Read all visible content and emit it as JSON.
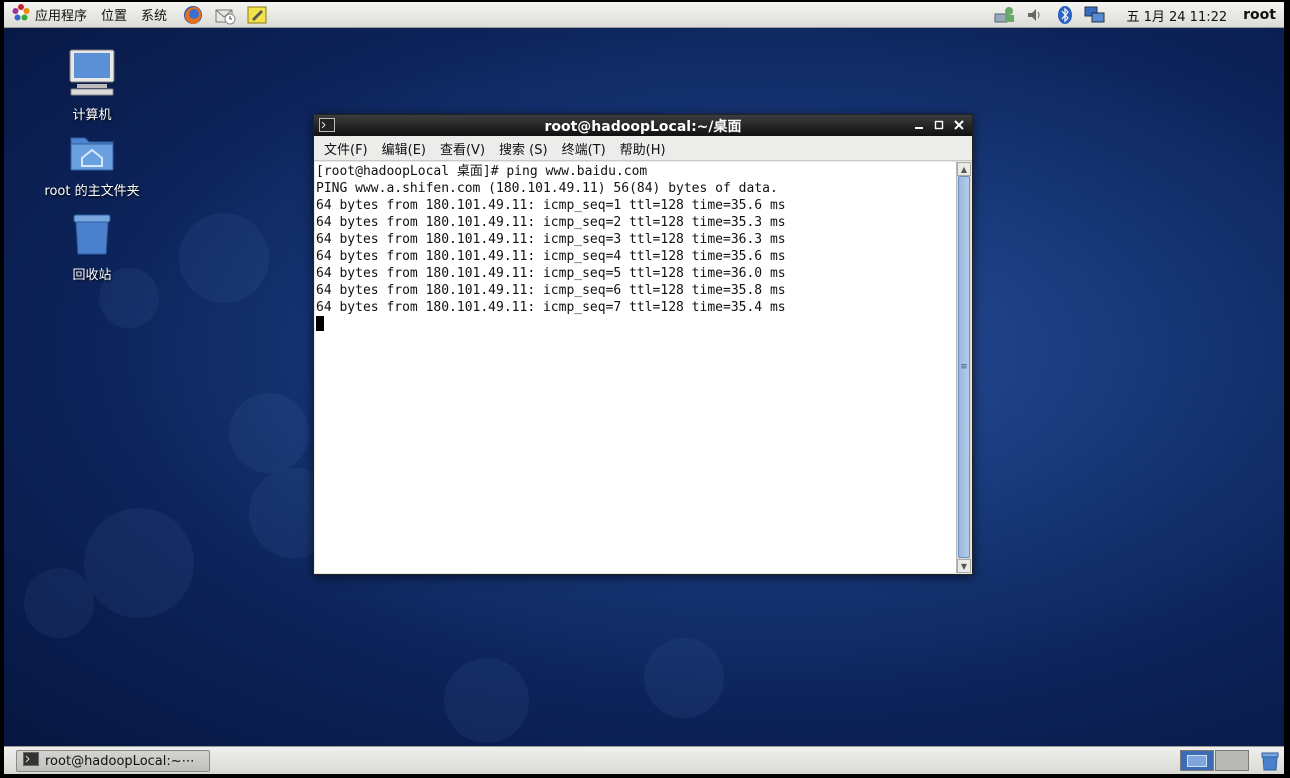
{
  "top_panel": {
    "menus": [
      {
        "label": "应用程序"
      },
      {
        "label": "位置"
      },
      {
        "label": "系统"
      }
    ],
    "clock": "五 1月 24 11:22",
    "user": "root"
  },
  "desktop": {
    "icons": [
      {
        "label": "计算机"
      },
      {
        "label": "root 的主文件夹"
      },
      {
        "label": "回收站"
      }
    ]
  },
  "terminal": {
    "title": "root@hadoopLocal:~/桌面",
    "menu": [
      "文件(F)",
      "编辑(E)",
      "查看(V)",
      "搜索 (S)",
      "终端(T)",
      "帮助(H)"
    ],
    "lines": [
      "[root@hadoopLocal 桌面]# ping www.baidu.com",
      "PING www.a.shifen.com (180.101.49.11) 56(84) bytes of data.",
      "64 bytes from 180.101.49.11: icmp_seq=1 ttl=128 time=35.6 ms",
      "64 bytes from 180.101.49.11: icmp_seq=2 ttl=128 time=35.3 ms",
      "64 bytes from 180.101.49.11: icmp_seq=3 ttl=128 time=36.3 ms",
      "64 bytes from 180.101.49.11: icmp_seq=4 ttl=128 time=35.6 ms",
      "64 bytes from 180.101.49.11: icmp_seq=5 ttl=128 time=36.0 ms",
      "64 bytes from 180.101.49.11: icmp_seq=6 ttl=128 time=35.8 ms",
      "64 bytes from 180.101.49.11: icmp_seq=7 ttl=128 time=35.4 ms"
    ]
  },
  "bottom_panel": {
    "task_label": "root@hadoopLocal:~⋯"
  },
  "colors": {
    "desktop_bg": "#0c2258",
    "titlebar": "#111111",
    "workspace_active": "#3e6cb4"
  }
}
